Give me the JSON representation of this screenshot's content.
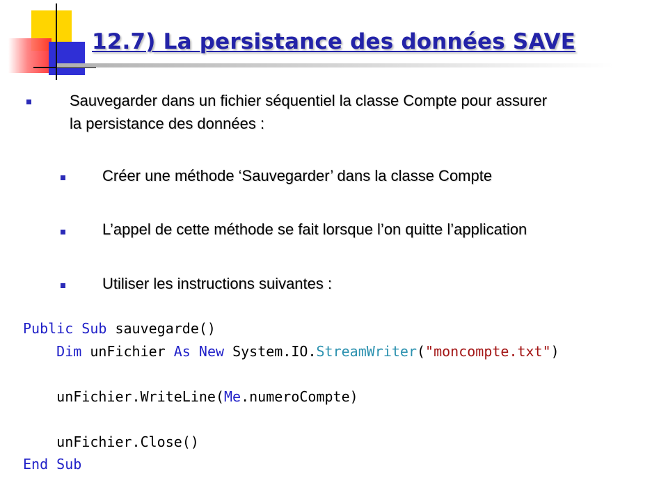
{
  "slide": {
    "title": "12.7) La persistance des données SAVE",
    "colors": {
      "title": "#2323a8",
      "bullet": "#2b2bb8",
      "keyword": "#2020c8",
      "type": "#2b91af",
      "string": "#a31515"
    },
    "bullets": [
      {
        "level": 1,
        "line1": "Sauvegarder dans un fichier séquentiel la classe Compte pour assurer",
        "line2": "la persistance des données :"
      },
      {
        "level": 2,
        "text": "Créer une méthode ‘Sauvegarder’ dans la classe Compte"
      },
      {
        "level": 2,
        "text": "L’appel de cette méthode se fait lorsque l’on quitte l’application"
      },
      {
        "level": 2,
        "text": "Utiliser les instructions suivantes :"
      }
    ],
    "code": {
      "line1": {
        "kw1": "Public",
        "kw2": "Sub",
        "rest": "sauvegarde()"
      },
      "line2": {
        "kw1": "Dim",
        "name": "unFichier",
        "kw2": "As",
        "kw3": "New",
        "ns": "System.IO.",
        "type": "StreamWriter",
        "open": "(",
        "string": "\"moncompte.txt\"",
        "close": ")"
      },
      "line3": {
        "obj": "unFichier.WriteLine(",
        "kw": "Me",
        "rest": ".numeroCompte)"
      },
      "line4": {
        "text": "unFichier.Close()"
      },
      "line5": {
        "kw1": "End",
        "kw2": "Sub"
      }
    }
  }
}
